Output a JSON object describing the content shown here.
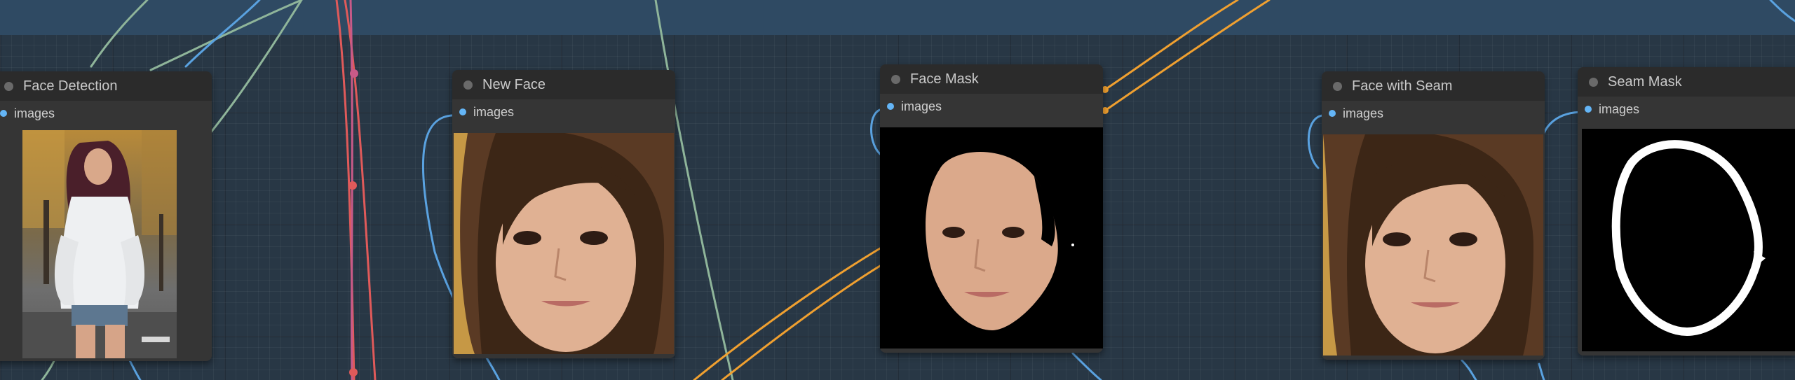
{
  "nodes": [
    {
      "title": "Face Detection",
      "slot": "images",
      "preview": "full-body photo"
    },
    {
      "title": "New Face",
      "slot": "images",
      "preview": "face crop"
    },
    {
      "title": "Face Mask",
      "slot": "images",
      "preview": "masked face on black"
    },
    {
      "title": "Face with Seam",
      "slot": "images",
      "preview": "face crop with seam"
    },
    {
      "title": "Seam Mask",
      "slot": "images",
      "preview": "white seam outline on black"
    }
  ],
  "colors": {
    "canvas": "#283745",
    "node_body": "#353535",
    "node_header": "#2b2b2b",
    "slot_images": "#64b5f6",
    "wire_image": "#5aa2e0",
    "wire_mask": "#8fb59a",
    "wire_orange": "#f0a030",
    "wire_red": "#e05a5a"
  }
}
